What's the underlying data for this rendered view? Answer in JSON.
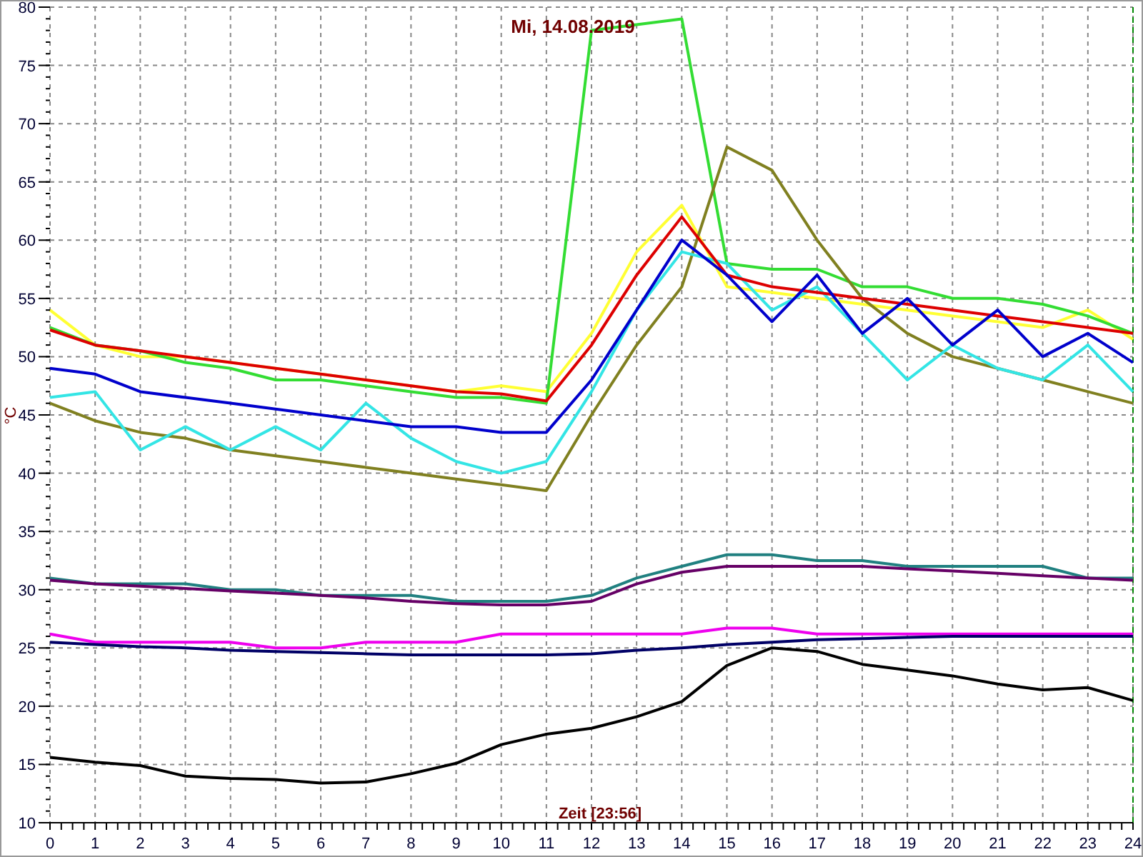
{
  "chart": {
    "chart_data": {
      "type": "line",
      "title": "Mi, 14.08.2019",
      "xlabel": "Zeit [23:56]",
      "ylabel": "°C",
      "x": [
        0,
        1,
        2,
        3,
        4,
        5,
        6,
        7,
        8,
        9,
        10,
        11,
        12,
        13,
        14,
        15,
        16,
        17,
        18,
        19,
        20,
        21,
        22,
        23,
        24
      ],
      "grid": true,
      "xlim": [
        0,
        24
      ],
      "ylim": [
        10,
        80
      ],
      "xticks": [
        0,
        1,
        2,
        3,
        4,
        5,
        6,
        7,
        8,
        9,
        10,
        11,
        12,
        13,
        14,
        15,
        16,
        17,
        18,
        19,
        20,
        21,
        22,
        23,
        24
      ],
      "yticks": [
        10,
        15,
        20,
        25,
        30,
        35,
        40,
        45,
        50,
        55,
        60,
        65,
        70,
        75,
        80
      ],
      "series": [
        {
          "color": "#ffff33",
          "values": [
            54,
            51,
            50,
            50,
            49.5,
            49,
            48.5,
            48,
            47.5,
            47,
            47.5,
            47,
            52,
            59,
            63,
            56,
            55.5,
            55,
            54.5,
            54,
            53.5,
            53,
            52.5,
            54,
            51.5
          ]
        },
        {
          "color": "#33dd33",
          "values": [
            52.5,
            51,
            50.5,
            49.5,
            49,
            48,
            48,
            47.5,
            47,
            46.5,
            46.5,
            46,
            78,
            78.5,
            79,
            58,
            57.5,
            57.5,
            56,
            56,
            55,
            55,
            54.5,
            53.5,
            52
          ]
        },
        {
          "color": "#808020",
          "values": [
            46,
            44.5,
            43.5,
            43,
            42,
            41.5,
            41,
            40.5,
            40,
            39.5,
            39,
            38.5,
            45,
            51,
            56,
            68,
            66,
            60,
            55,
            52,
            50,
            49,
            48,
            47,
            46
          ]
        },
        {
          "color": "#33e5e5",
          "values": [
            46.5,
            47,
            42,
            44,
            42,
            44,
            42,
            46,
            43,
            41,
            40,
            41,
            47,
            54,
            59,
            58,
            54,
            56,
            52,
            48,
            51,
            49,
            48,
            51,
            47
          ]
        },
        {
          "color": "#dd0000",
          "values": [
            52.3,
            51,
            50.5,
            50,
            49.5,
            49,
            48.5,
            48,
            47.5,
            47,
            46.8,
            46.2,
            51,
            57,
            62,
            57,
            56,
            55.5,
            55,
            54.5,
            54,
            53.5,
            53,
            52.5,
            52
          ]
        },
        {
          "color": "#0000cc",
          "values": [
            49,
            48.5,
            47,
            46.5,
            46,
            45.5,
            45,
            44.5,
            44,
            44,
            43.5,
            43.5,
            48,
            54,
            60,
            57,
            53,
            57,
            52,
            55,
            51,
            54,
            50,
            52,
            49.5
          ]
        },
        {
          "color": "#208080",
          "values": [
            31,
            30.5,
            30.5,
            30.5,
            30,
            30,
            29.5,
            29.5,
            29.5,
            29,
            29,
            29,
            29.5,
            31,
            32,
            33,
            33,
            32.5,
            32.5,
            32,
            32,
            32,
            32,
            31,
            31
          ]
        },
        {
          "color": "#660066",
          "values": [
            30.8,
            30.5,
            30.3,
            30.1,
            29.9,
            29.7,
            29.5,
            29.3,
            29,
            28.8,
            28.7,
            28.7,
            29,
            30.5,
            31.5,
            32,
            32,
            32,
            32,
            31.8,
            31.6,
            31.4,
            31.2,
            31,
            30.8
          ]
        },
        {
          "color": "#ee00ee",
          "values": [
            26.2,
            25.5,
            25.5,
            25.5,
            25.5,
            25,
            25,
            25.5,
            25.5,
            25.5,
            26.2,
            26.2,
            26.2,
            26.2,
            26.2,
            26.7,
            26.7,
            26.2,
            26.2,
            26.2,
            26.2,
            26.2,
            26.2,
            26.2,
            26.2
          ]
        },
        {
          "color": "#000066",
          "values": [
            25.5,
            25.3,
            25.1,
            25,
            24.8,
            24.7,
            24.6,
            24.5,
            24.4,
            24.4,
            24.4,
            24.4,
            24.5,
            24.8,
            25,
            25.3,
            25.5,
            25.7,
            25.8,
            25.9,
            26,
            26,
            26,
            26,
            26
          ]
        },
        {
          "color": "#000000",
          "values": [
            15.6,
            15.2,
            14.9,
            14,
            13.8,
            13.7,
            13.4,
            13.5,
            14.2,
            15.1,
            16.7,
            17.6,
            18.1,
            19.1,
            20.4,
            23.5,
            25,
            24.7,
            23.6,
            23.1,
            22.6,
            21.9,
            21.4,
            21.6,
            20.5
          ]
        }
      ]
    }
  }
}
